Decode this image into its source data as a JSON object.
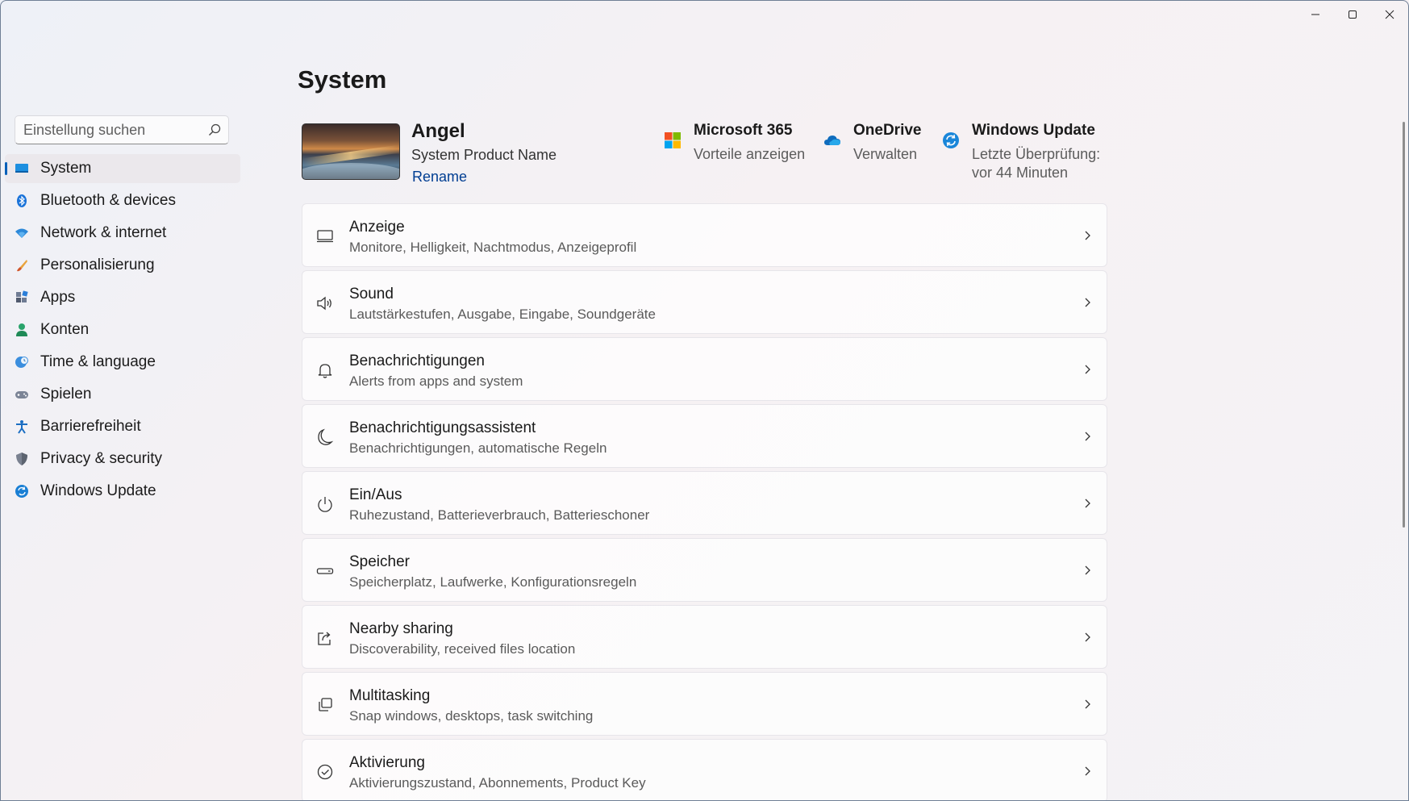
{
  "window": {
    "controls": {
      "minimize": "minimize-icon",
      "maximize": "maximize-icon",
      "close": "close-icon"
    }
  },
  "search": {
    "placeholder": "Einstellung suchen",
    "icon": "search-icon"
  },
  "sidebar": {
    "items": [
      {
        "label": "System",
        "icon": "monitor-icon",
        "active": true
      },
      {
        "label": "Bluetooth & devices",
        "icon": "bluetooth-icon"
      },
      {
        "label": "Network & internet",
        "icon": "wifi-icon"
      },
      {
        "label": "Personalisierung",
        "icon": "brush-icon"
      },
      {
        "label": "Apps",
        "icon": "apps-icon"
      },
      {
        "label": "Konten",
        "icon": "person-icon"
      },
      {
        "label": "Time & language",
        "icon": "globe-clock-icon"
      },
      {
        "label": "Spielen",
        "icon": "gamepad-icon"
      },
      {
        "label": "Barrierefreiheit",
        "icon": "accessibility-icon"
      },
      {
        "label": "Privacy & security",
        "icon": "shield-icon"
      },
      {
        "label": "Windows Update",
        "icon": "update-icon"
      }
    ]
  },
  "main": {
    "title": "System",
    "device": {
      "name": "Angel",
      "model": "System Product Name",
      "rename": "Rename"
    },
    "quick_links": [
      {
        "title": "Microsoft 365",
        "sub": "Vorteile anzeigen",
        "icon": "microsoft-logo-icon"
      },
      {
        "title": "OneDrive",
        "sub": "Verwalten",
        "icon": "cloud-icon"
      },
      {
        "title": "Windows Update",
        "sub": "Letzte Überprüfung:",
        "sub2": "vor 44 Minuten",
        "icon": "update-icon"
      }
    ],
    "cards": [
      {
        "title": "Anzeige",
        "sub": "Monitore, Helligkeit, Nachtmodus, Anzeigeprofil",
        "icon": "display-icon"
      },
      {
        "title": "Sound",
        "sub": "Lautstärkestufen, Ausgabe, Eingabe, Soundgeräte",
        "icon": "speaker-icon"
      },
      {
        "title": "Benachrichtigungen",
        "sub": "Alerts from apps and system",
        "icon": "bell-icon"
      },
      {
        "title": "Benachrichtigungsassistent",
        "sub": "Benachrichtigungen, automatische Regeln",
        "icon": "moon-icon"
      },
      {
        "title": "Ein/Aus",
        "sub": "Ruhezustand, Batterieverbrauch, Batterieschoner",
        "icon": "power-icon"
      },
      {
        "title": "Speicher",
        "sub": "Speicherplatz, Laufwerke, Konfigurationsregeln",
        "icon": "storage-icon"
      },
      {
        "title": "Nearby sharing",
        "sub": "Discoverability, received files location",
        "icon": "share-icon"
      },
      {
        "title": "Multitasking",
        "sub": "Snap windows, desktops, task switching",
        "icon": "multitasking-icon"
      },
      {
        "title": "Aktivierung",
        "sub": "Aktivierungszustand, Abonnements, Product Key",
        "icon": "check-circle-icon"
      }
    ]
  },
  "colors": {
    "accent": "#005fb8",
    "link": "#003e92"
  }
}
